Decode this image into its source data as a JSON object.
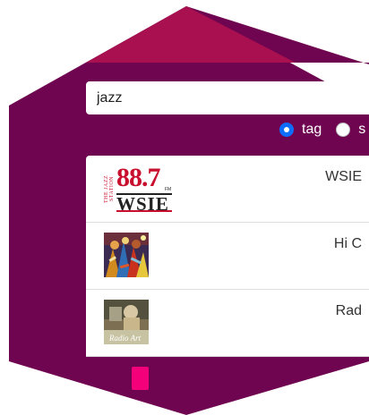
{
  "colors": {
    "hexagon_top": "#a8104f",
    "hexagon_body": "#6f0450",
    "accent_tab": "#f4007a",
    "radio_selected": "#0d6efd"
  },
  "search": {
    "value": "jazz"
  },
  "search_mode": {
    "options": [
      {
        "label": "tag",
        "selected": true
      },
      {
        "label": "s",
        "selected": false
      }
    ]
  },
  "stations": [
    {
      "title": "WSIE",
      "logo_text": {
        "side": "THE JAZZ STATION",
        "number": "88.7",
        "fm": "FM",
        "call": "WSIE"
      }
    },
    {
      "title": "Hi C"
    },
    {
      "title": "Rad",
      "logo_text": {
        "script": "Radio Art"
      }
    }
  ]
}
